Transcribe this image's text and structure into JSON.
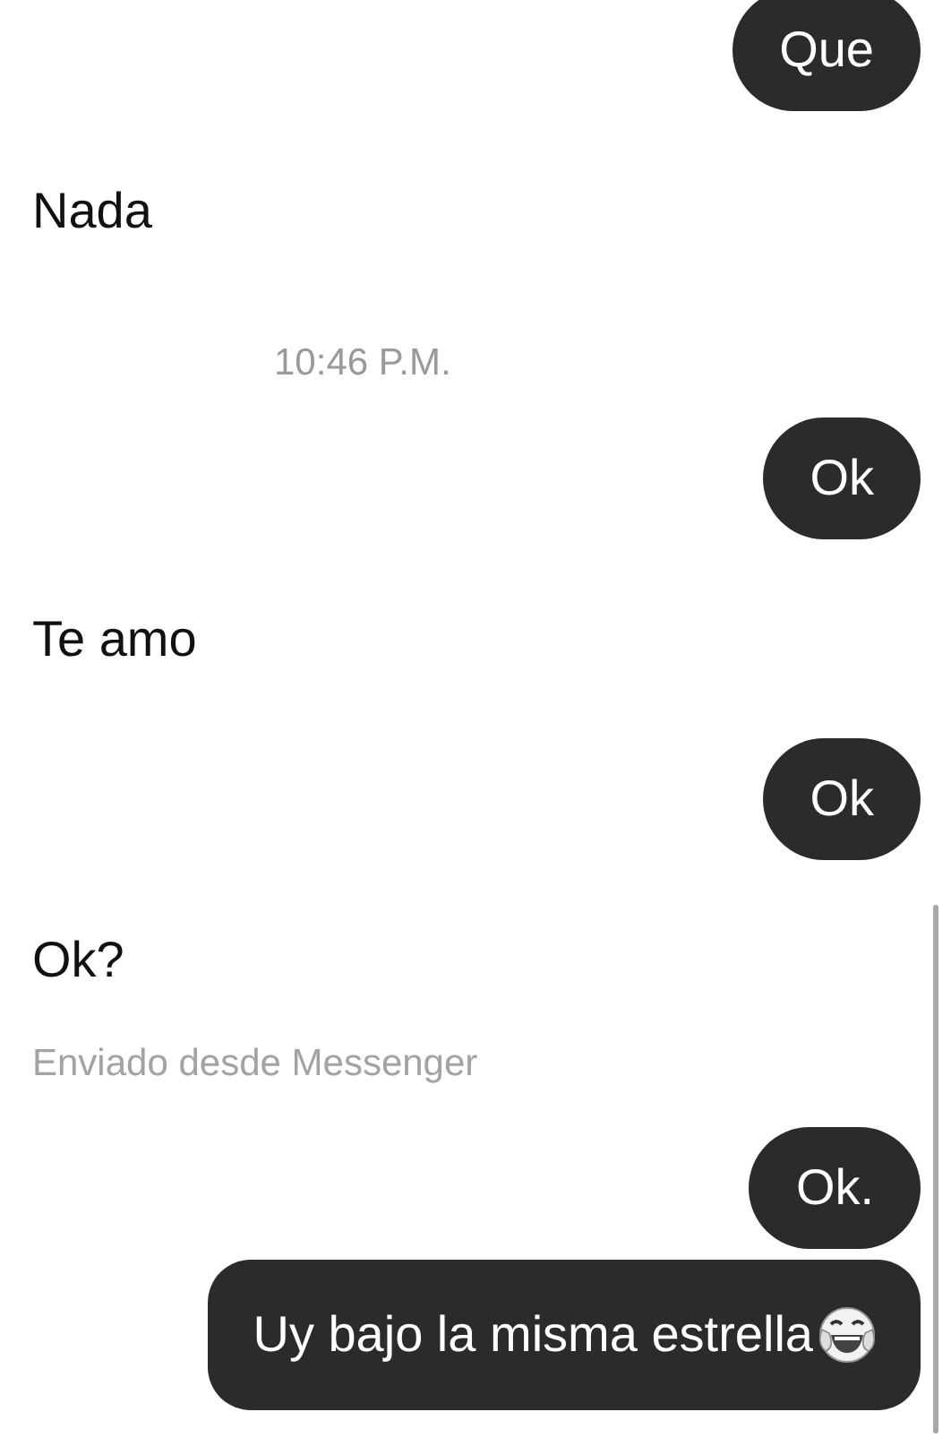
{
  "messages": [
    {
      "kind": "sent",
      "text": "Que"
    },
    {
      "kind": "received",
      "text": "Nada"
    },
    {
      "kind": "timestamp",
      "text": "10:46 P.M."
    },
    {
      "kind": "sent",
      "text": "Ok"
    },
    {
      "kind": "received",
      "text": "Te amo"
    },
    {
      "kind": "sent",
      "text": "Ok"
    },
    {
      "kind": "received",
      "text": "Ok?"
    },
    {
      "kind": "note",
      "text": "Enviado desde Messenger"
    },
    {
      "kind": "sent",
      "text": "Ok."
    },
    {
      "kind": "sent",
      "text": "Uy bajo la misma estrella",
      "trailing_emoji": true
    }
  ]
}
